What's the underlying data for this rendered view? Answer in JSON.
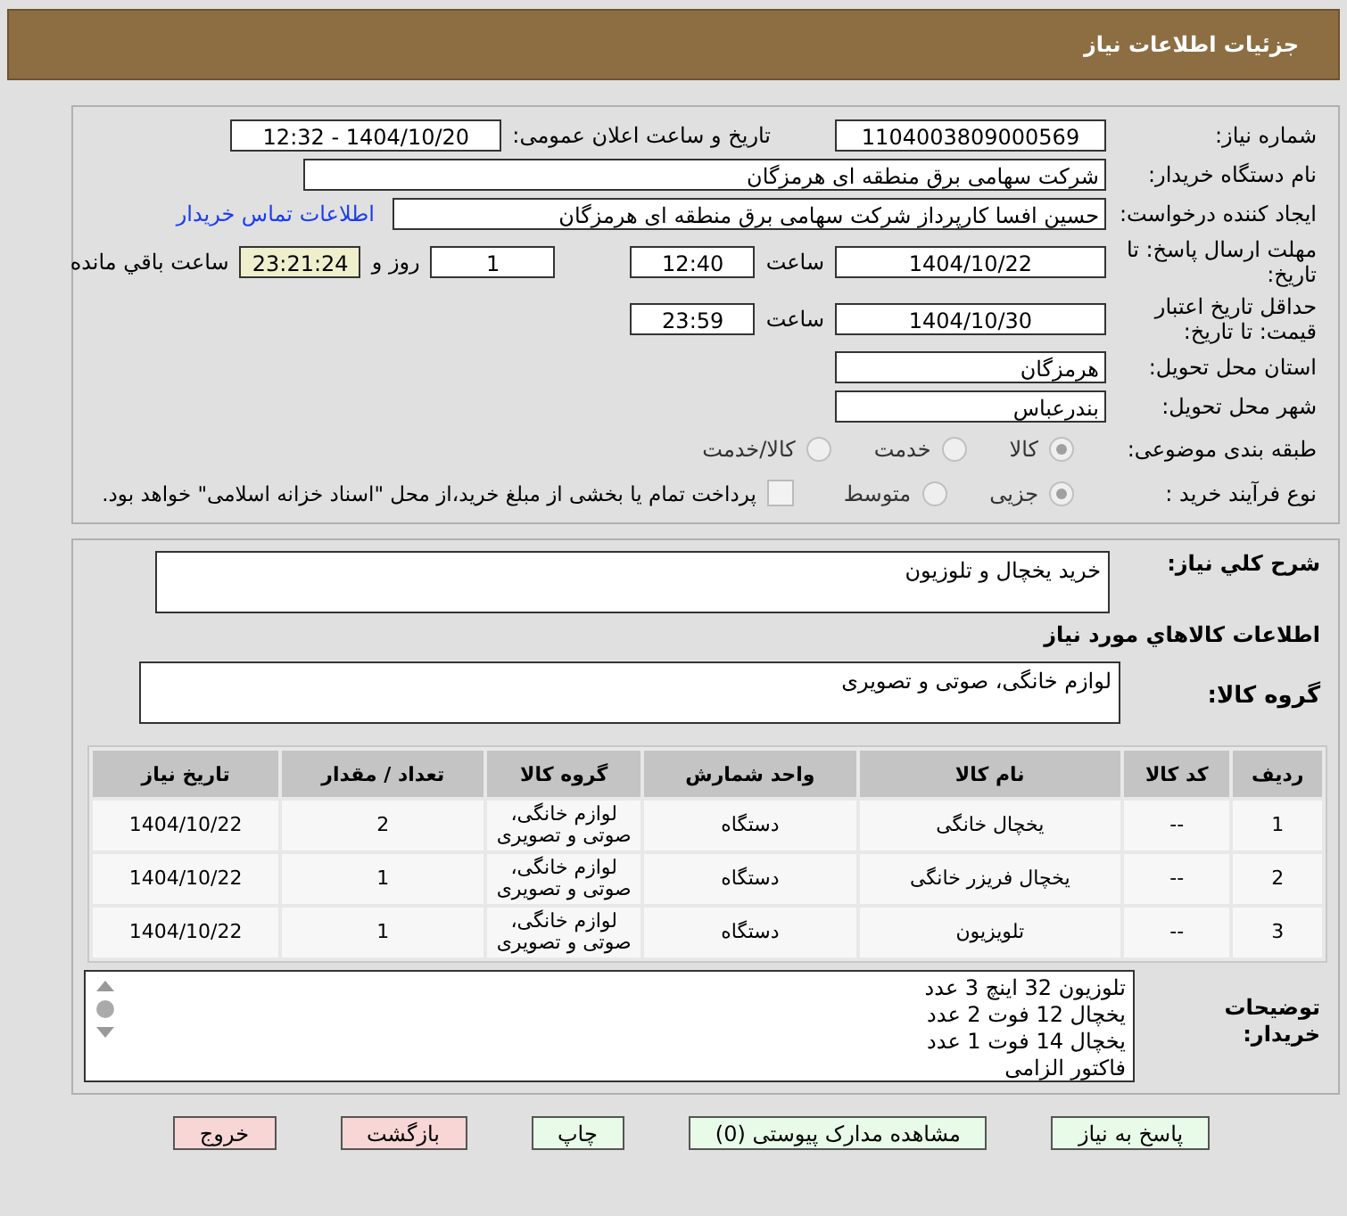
{
  "header": {
    "title": "جزئیات اطلاعات نیاز"
  },
  "need_number": {
    "label": "شماره نیاز:",
    "value": "1104003809000569"
  },
  "announce": {
    "label": "تاریخ و ساعت اعلان عمومی:",
    "value": "1404/10/20 - 12:32"
  },
  "buyer": {
    "label": "نام دستگاه خریدار:",
    "value": "شرکت سهامی برق منطقه ای هرمزگان"
  },
  "creator": {
    "label": "ایجاد کننده درخواست:",
    "value": "حسین افسا کارپرداز شرکت سهامی برق منطقه ای هرمزگان",
    "link": "اطلاعات تماس خریدار"
  },
  "deadline": {
    "label": "مهلت ارسال پاسخ: تا تاریخ:",
    "date": "1404/10/22",
    "time_label": "ساعت",
    "time": "12:40",
    "days": "1",
    "days_label": "روز و",
    "remaining": "23:21:24",
    "remaining_label": "ساعت باقي مانده"
  },
  "validity": {
    "label": "حداقل تاریخ اعتبار قیمت: تا تاریخ:",
    "date": "1404/10/30",
    "time_label": "ساعت",
    "time": "23:59"
  },
  "province": {
    "label": "استان محل تحویل:",
    "value": "هرمزگان"
  },
  "city": {
    "label": "شهر محل تحویل:",
    "value": "بندرعباس"
  },
  "category": {
    "label": "طبقه بندی موضوعی:",
    "options": [
      {
        "label": "کالا",
        "selected": true
      },
      {
        "label": "خدمت",
        "selected": false
      },
      {
        "label": "کالا/خدمت",
        "selected": false
      }
    ]
  },
  "process": {
    "label": "نوع فرآیند خرید :",
    "options": [
      {
        "label": "جزیی",
        "selected": true
      },
      {
        "label": "متوسط",
        "selected": false
      }
    ],
    "payment": {
      "checked": false,
      "text": "پرداخت تمام یا بخشی از مبلغ خرید،از محل \"اسناد خزانه اسلامی\" خواهد بود."
    }
  },
  "summary": {
    "label": "شرح کلي نياز:",
    "value": "خرید یخچال و تلوزیون"
  },
  "goods_heading": "اطلاعات کالاهاي مورد نياز",
  "goods_group": {
    "label": "گروه کالا:",
    "value": "لوازم خانگی، صوتی و تصویری"
  },
  "table": {
    "columns": [
      "رديف",
      "کد کالا",
      "نام کالا",
      "واحد شمارش",
      "گروه کالا",
      "تعداد / مقدار",
      "تاریخ نیاز"
    ],
    "rows": [
      [
        "1",
        "--",
        "یخچال خانگی",
        "دستگاه",
        "لوازم خانگی، صوتی و تصویری",
        "2",
        "1404/10/22"
      ],
      [
        "2",
        "--",
        "یخچال فریزر خانگی",
        "دستگاه",
        "لوازم خانگی، صوتی و تصویری",
        "1",
        "1404/10/22"
      ],
      [
        "3",
        "--",
        "تلویزیون",
        "دستگاه",
        "لوازم خانگی، صوتی و تصویری",
        "1",
        "1404/10/22"
      ]
    ]
  },
  "buyer_notes": {
    "label": "توضیحات خریدار:",
    "lines": [
      "تلوزیون 32 اینچ 3 عدد",
      "یخچال 12 فوت 2 عدد",
      "یخچال 14 فوت 1 عدد",
      "فاکتور الزامی"
    ]
  },
  "buttons": [
    {
      "label": "پاسخ به نیاز",
      "kind": "green"
    },
    {
      "label": "مشاهده مدارک پیوستی (0)",
      "kind": "green"
    },
    {
      "label": "چاپ",
      "kind": "green"
    },
    {
      "label": "بازگشت",
      "kind": "red"
    },
    {
      "label": "خروج",
      "kind": "red"
    }
  ]
}
